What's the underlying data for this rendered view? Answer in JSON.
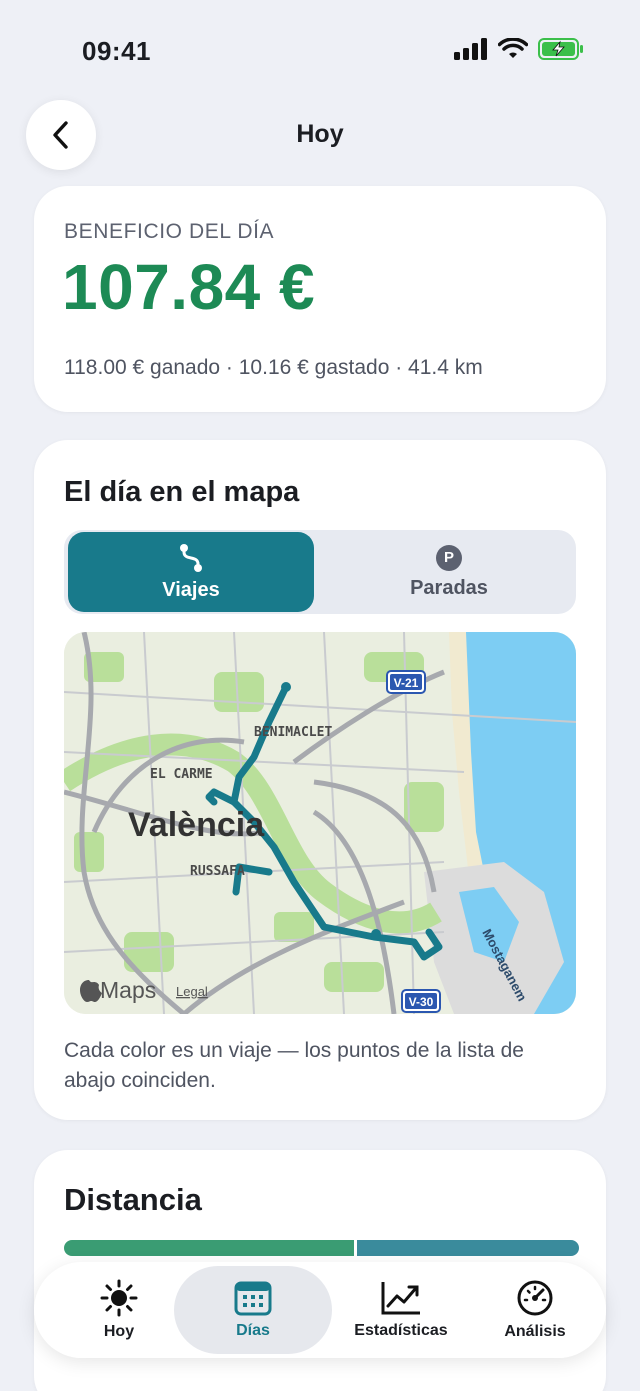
{
  "status_bar": {
    "time": "09:41"
  },
  "nav": {
    "title": "Hoy"
  },
  "profit": {
    "label": "BENEFICIO DEL DÍA",
    "value": "107.84 €",
    "detail": "118.00 € ganado · 10.16 € gastado · 41.4 km"
  },
  "map_section": {
    "title": "El día en el mapa",
    "segments": [
      {
        "label": "Viajes",
        "icon": "route-icon",
        "selected": true
      },
      {
        "label": "Paradas",
        "icon": "parking-icon",
        "badge": "P",
        "selected": false
      }
    ],
    "map": {
      "city_label": "València",
      "district_labels": [
        "BENIMACLET",
        "EL CARME",
        "RUSSAFA",
        "Mostaganem"
      ],
      "road_shields": [
        "V-21",
        "V-30"
      ],
      "attribution": "Maps",
      "legal": "Legal",
      "route_color": "#187a8b"
    },
    "caption": "Cada color es un viaje — los puntos de la lista de abajo coinciden."
  },
  "distance_section": {
    "title": "Distancia",
    "bar_colors": [
      "#3a9c73",
      "#3a8b9c"
    ]
  },
  "tab_bar": {
    "items": [
      {
        "label": "Hoy",
        "icon": "sun-icon"
      },
      {
        "label": "Días",
        "icon": "calendar-icon",
        "active": true
      },
      {
        "label": "Estadísticas",
        "icon": "chart-icon"
      },
      {
        "label": "Análisis",
        "icon": "gauge-icon"
      }
    ]
  },
  "colors": {
    "accent": "#187a8b",
    "profit_green": "#1d8a55",
    "background": "#eef0f6"
  }
}
